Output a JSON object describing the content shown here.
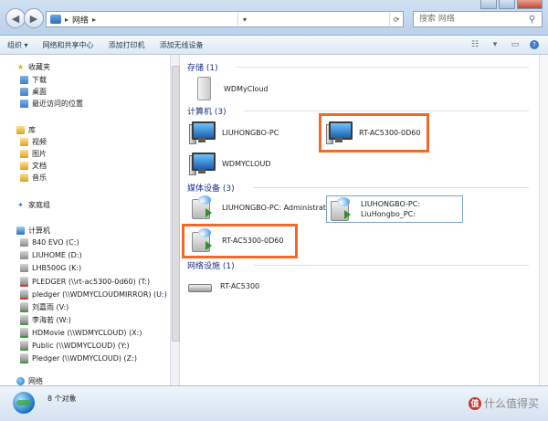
{
  "address": {
    "breadcrumb": "网络",
    "search_placeholder": "搜索 网络"
  },
  "toolbar": {
    "organize": "组织 ▾",
    "network_center": "网络和共享中心",
    "add_printer": "添加打印机",
    "add_wireless": "添加无线设备"
  },
  "sidebar": {
    "favorites": "收藏夹",
    "downloads": "下载",
    "desktop": "桌面",
    "recent": "最近访问的位置",
    "libraries": "库",
    "videos": "视频",
    "pictures": "图片",
    "documents": "文档",
    "music": "音乐",
    "homegroup": "家庭组",
    "computer": "计算机",
    "drives": [
      "840 EVO (C:)",
      "LIUHOME (D:)",
      "LHB500G (K:)",
      "PLEDGER (\\\\rt-ac5300-0d60) (T:)",
      "pledger (\\\\WDMYCLOUDMIRROR) (U:)",
      "刘嘉雨 (V:)",
      "李海若 (W:)",
      "HDMovie (\\\\WDMYCLOUD) (X:)",
      "Public (\\\\WDMYCLOUD) (Y:)",
      "Pledger (\\\\WDMYCLOUD) (Z:)"
    ],
    "network": "网络"
  },
  "groups": {
    "storage": {
      "title": "存储 (1)",
      "items": [
        "WDMyCloud"
      ]
    },
    "computers": {
      "title": "计算机 (3)",
      "items": [
        "LIUHONGBO-PC",
        "RT-AC5300-0D60",
        "WDMYCLOUD"
      ]
    },
    "media": {
      "title": "媒体设备 (3)",
      "items": [
        "LIUHONGBO-PC: Administrator:",
        "LIUHONGBO-PC:",
        "LiuHongbo_PC:",
        "RT-AC5300-0D60"
      ]
    },
    "infrastructure": {
      "title": "网络设施 (1)",
      "items": [
        "RT-AC5300"
      ]
    }
  },
  "status": {
    "count": "8 个对象"
  },
  "watermark": {
    "logo": "值",
    "text": "什么值得买"
  },
  "colors": {
    "highlight": "#f06a2a",
    "group_header": "#1e3287",
    "selection_border": "#7da2ce"
  }
}
